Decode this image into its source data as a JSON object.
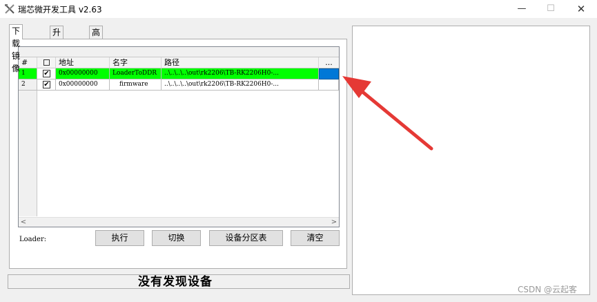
{
  "window": {
    "title": "瑞芯微开发工具 v2.63",
    "minimize_glyph": "—",
    "maximize_glyph": "☐",
    "close_glyph": "✕"
  },
  "tabs": [
    {
      "label": "下载镜像",
      "active": true
    },
    {
      "label": "升级固件",
      "active": false
    },
    {
      "label": "高级功能",
      "active": false
    }
  ],
  "table": {
    "columns": [
      "#",
      "",
      "地址",
      "名字",
      "路径",
      "..."
    ],
    "rows": [
      {
        "index": "1",
        "checked": true,
        "address": "0x00000000",
        "name": "LoaderToDDR",
        "path": "..\\..\\..\\..\\out\\rk2206\\TB-RK2206H0-...",
        "selected": true
      },
      {
        "index": "2",
        "checked": true,
        "address": "0x00000000",
        "name": "firmware",
        "path": "..\\..\\..\\..\\out\\rk2206\\TB-RK2206H0-...",
        "selected": false
      }
    ],
    "check_glyph": "✔"
  },
  "scroll": {
    "left_glyph": "<",
    "right_glyph": ">"
  },
  "loader_label": "Loader:",
  "buttons": {
    "execute": "执行",
    "switch": "切换",
    "partition_table": "设备分区表",
    "clear": "清空"
  },
  "status_text": "没有发现设备",
  "watermark": "CSDN @云起客",
  "colors": {
    "selected_row": "#00ff00",
    "path_button": "#0078d7",
    "annotation_arrow": "#e53935"
  }
}
